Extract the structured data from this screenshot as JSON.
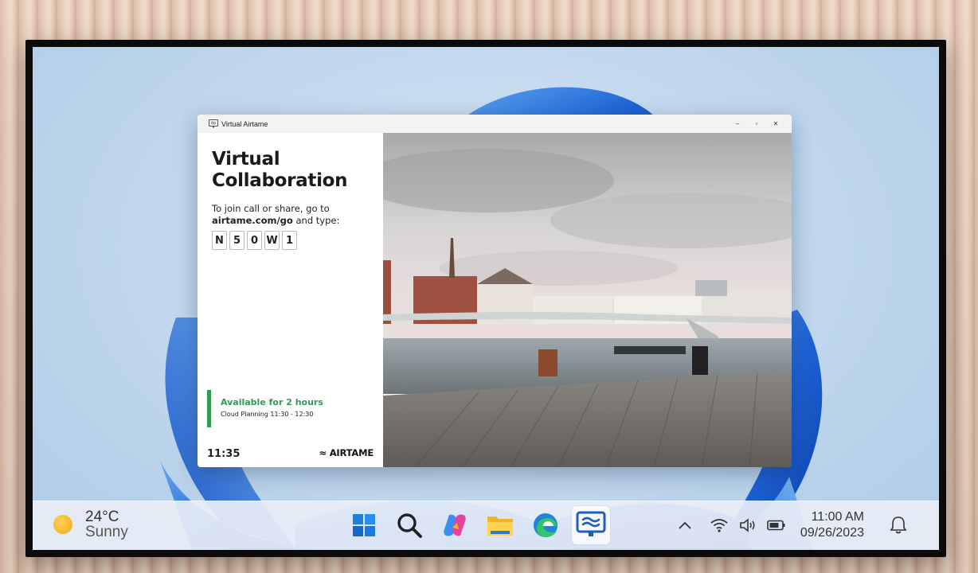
{
  "window": {
    "title": "Virtual Airtame",
    "minimize": "–",
    "maximize": "▫",
    "close": "✕"
  },
  "panel": {
    "headline_line1": "Virtual",
    "headline_line2": "Collaboration",
    "instruction_line1": "To join call or share, go to",
    "instruction_link": "airtame.com/go",
    "instruction_suffix": "and type:",
    "code": [
      "N",
      "5",
      "0",
      "W",
      "1"
    ],
    "availability": "Available for 2 hours",
    "meeting": "Cloud Planning 11:30 - 12:30",
    "clock": "11:35",
    "brand": "≈ AIRTAME"
  },
  "taskbar": {
    "weather_temp": "24°C",
    "weather_condition": "Sunny",
    "apps": [
      "windows-start-icon",
      "search-icon",
      "copilot-icon",
      "file-explorer-icon",
      "edge-icon",
      "airtame-icon"
    ],
    "time": "11:00 AM",
    "date": "09/26/2023"
  },
  "colors": {
    "accent_green": "#2e9a52",
    "taskbar_bg": "#e8eef6",
    "windows_blue": "#2b73d8"
  }
}
